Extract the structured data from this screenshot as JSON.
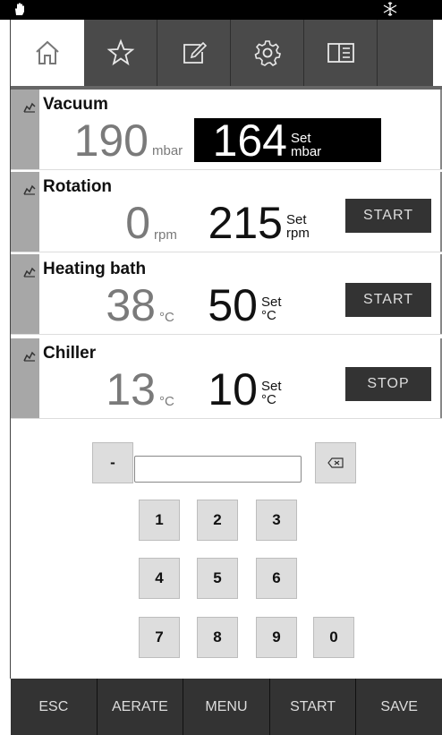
{
  "status_bar": {
    "left_icon": "hand-icon",
    "right_icon": "snowflake-icon"
  },
  "tabs": [
    {
      "icon": "home-icon",
      "active": true
    },
    {
      "icon": "star-icon",
      "active": false
    },
    {
      "icon": "edit-icon",
      "active": false
    },
    {
      "icon": "gear-icon",
      "active": false
    },
    {
      "icon": "book-icon",
      "active": false
    }
  ],
  "devices": {
    "vacuum": {
      "name": "Vacuum",
      "value": "190",
      "unit": "mbar",
      "set_value": "164",
      "set_label": "Set",
      "set_unit": "mbar"
    },
    "rotation": {
      "name": "Rotation",
      "value": "0",
      "unit": "rpm",
      "set_value": "215",
      "set_label": "Set",
      "set_unit": "rpm",
      "button": "START"
    },
    "heating": {
      "name": "Heating bath",
      "value": "38",
      "unit": "°C",
      "set_value": "50",
      "set_label": "Set",
      "set_unit": "°C",
      "button": "START"
    },
    "chiller": {
      "name": "Chiller",
      "value": "13",
      "unit": "°C",
      "set_value": "10",
      "set_label": "Set",
      "set_unit": "°C",
      "button": "STOP"
    }
  },
  "keypad": {
    "minus": "-",
    "input_value": "",
    "backspace_icon": "backspace-icon",
    "keys": [
      "1",
      "2",
      "3",
      "4",
      "5",
      "6",
      "7",
      "8",
      "9",
      "0"
    ]
  },
  "bottom_bar": [
    "ESC",
    "AERATE",
    "MENU",
    "START",
    "SAVE"
  ]
}
